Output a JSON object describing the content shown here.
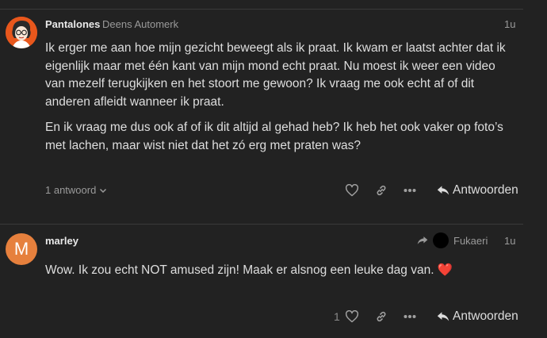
{
  "post1": {
    "username": "Pantalones",
    "user_title": "Deens Automerk",
    "time": "1u",
    "paragraphs": [
      "Ik erger me aan hoe mijn gezicht beweegt als ik praat. Ik kwam er laatst achter dat ik eigenlijk maar met één kant van mijn mond echt praat. Nu moest ik weer een video van mezelf terugkijken en het stoort me gewoon? Ik vraag me ook echt af of dit anderen afleidt wanneer ik praat.",
      "En ik vraag me dus ook af of ik dit altijd al gehad heb? Ik heb het ook vaker op foto’s met lachen, maar wist niet dat het zó erg met praten was?"
    ],
    "replies_label": "1 antwoord",
    "reply_label": "Antwoorden"
  },
  "post2": {
    "avatar_letter": "M",
    "username": "marley",
    "reply_to_user": "Fukaeri",
    "time": "1u",
    "text": "Wow. Ik zou echt NOT amused zijn! Maak er alsnog een leuke dag van.",
    "emoji": "❤️",
    "like_count": "1",
    "reply_label": "Antwoorden"
  },
  "colors": {
    "background": "#222222",
    "avatar_m": "#e6803d",
    "avatar_p": "#e8571c",
    "heart_emoji": "#e02828"
  }
}
